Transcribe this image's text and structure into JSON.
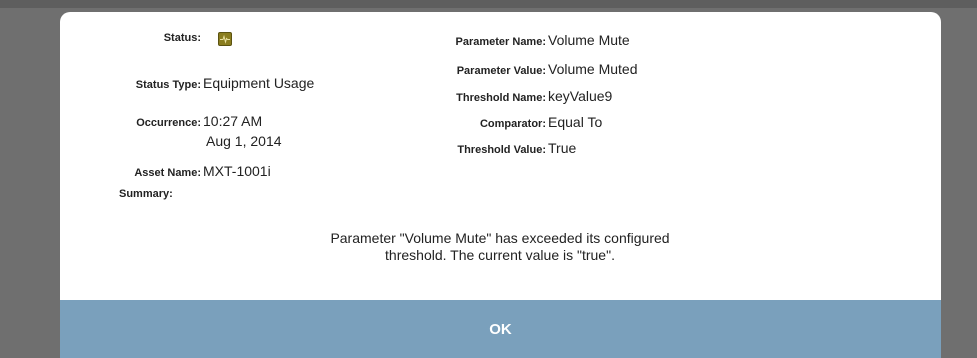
{
  "dialog": {
    "left_fields": {
      "status_label": "Status:",
      "status_type_label": "Status Type:",
      "status_type_value": "Equipment Usage",
      "occurrence_label": "Occurrence:",
      "occurrence_time": "10:27 AM",
      "occurrence_date": "Aug 1, 2014",
      "asset_name_label": "Asset Name:",
      "asset_name_value": "MXT-1001i",
      "summary_label": "Summary:"
    },
    "right_fields": {
      "parameter_name_label": "Parameter Name:",
      "parameter_name_value": "Volume Mute",
      "parameter_value_label": "Parameter Value:",
      "parameter_value_value": "Volume Muted",
      "threshold_name_label": "Threshold Name:",
      "threshold_name_value": "keyValue9",
      "comparator_label": "Comparator:",
      "comparator_value": "Equal To",
      "threshold_value_label": "Threshold Value:",
      "threshold_value_value": "True"
    },
    "status_icon": "activity-pulse-icon",
    "status_icon_color": "#8a7d1e",
    "summary_text": "Parameter \"Volume Mute\" has exceeded its configured threshold.  The current value is \"true\".",
    "ok_label": "OK",
    "ok_bar_color": "#7aa0bc"
  }
}
